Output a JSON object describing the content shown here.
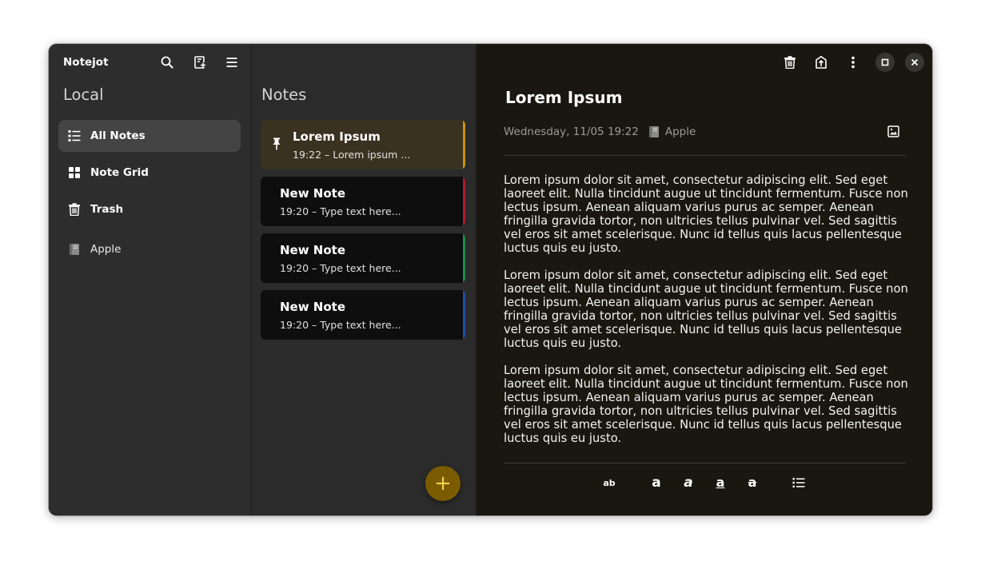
{
  "colors": {
    "accent": "#f6d24a",
    "fab": "#7a5b00",
    "sidebar_bg": "#2d2d2d",
    "editor_bg": "#19170f"
  },
  "sidebar": {
    "app_title": "Notejot",
    "section_title": "Local",
    "items": [
      {
        "label": "All Notes",
        "icon": "list-icon",
        "active": true
      },
      {
        "label": "Note Grid",
        "icon": "grid-icon",
        "active": false
      },
      {
        "label": "Trash",
        "icon": "trash-icon",
        "active": false
      }
    ],
    "notebook": {
      "label": "Apple",
      "icon": "notebook-icon"
    }
  },
  "notelist": {
    "title": "Notes",
    "notes": [
      {
        "title": "Lorem Ipsum",
        "subtitle": "19:22 – Lorem ipsum ...",
        "pinned": true,
        "bg": "#3a3221",
        "stripe": "#c8920e"
      },
      {
        "title": "New Note",
        "subtitle": "19:20 – Type text here...",
        "pinned": false,
        "bg": "#0e0e0e",
        "stripe": "#b01a2a"
      },
      {
        "title": "New Note",
        "subtitle": "19:20 – Type text here...",
        "pinned": false,
        "bg": "#0e0e0e",
        "stripe": "#1f8a45"
      },
      {
        "title": "New Note",
        "subtitle": "19:20 – Type text here...",
        "pinned": false,
        "bg": "#0e0e0e",
        "stripe": "#1c4fa8"
      }
    ],
    "fab_label": "+"
  },
  "editor": {
    "title": "Lorem Ipsum",
    "date": "Wednesday, 11/05 19:22",
    "notebook": "Apple",
    "paragraphs": [
      "Lorem ipsum dolor sit amet, consectetur adipiscing elit. Sed eget laoreet elit. Nulla tincidunt augue ut tincidunt fermentum. Fusce non lectus ipsum. Aenean aliquam varius purus ac semper. Aenean fringilla gravida tortor, non ultricies tellus pulvinar vel. Sed sagittis vel eros sit amet scelerisque. Nunc id tellus quis lacus pellentesque luctus quis eu justo.",
      "Lorem ipsum dolor sit amet, consectetur adipiscing elit. Sed eget laoreet elit. Nulla tincidunt augue ut tincidunt fermentum. Fusce non lectus ipsum. Aenean aliquam varius purus ac semper. Aenean fringilla gravida tortor, non ultricies tellus pulvinar vel. Sed sagittis vel eros sit amet scelerisque. Nunc id tellus quis lacus pellentesque luctus quis eu justo.",
      "Lorem ipsum dolor sit amet, consectetur adipiscing elit. Sed eget laoreet elit. Nulla tincidunt augue ut tincidunt fermentum. Fusce non lectus ipsum. Aenean aliquam varius purus ac semper. Aenean fringilla gravida tortor, non ultricies tellus pulvinar vel. Sed sagittis vel eros sit amet scelerisque. Nunc id tellus quis lacus pellentesque luctus quis eu justo."
    ],
    "format_buttons": {
      "normal": "ab",
      "bold": "a",
      "italic": "a",
      "underline": "a",
      "strike": "a"
    }
  }
}
